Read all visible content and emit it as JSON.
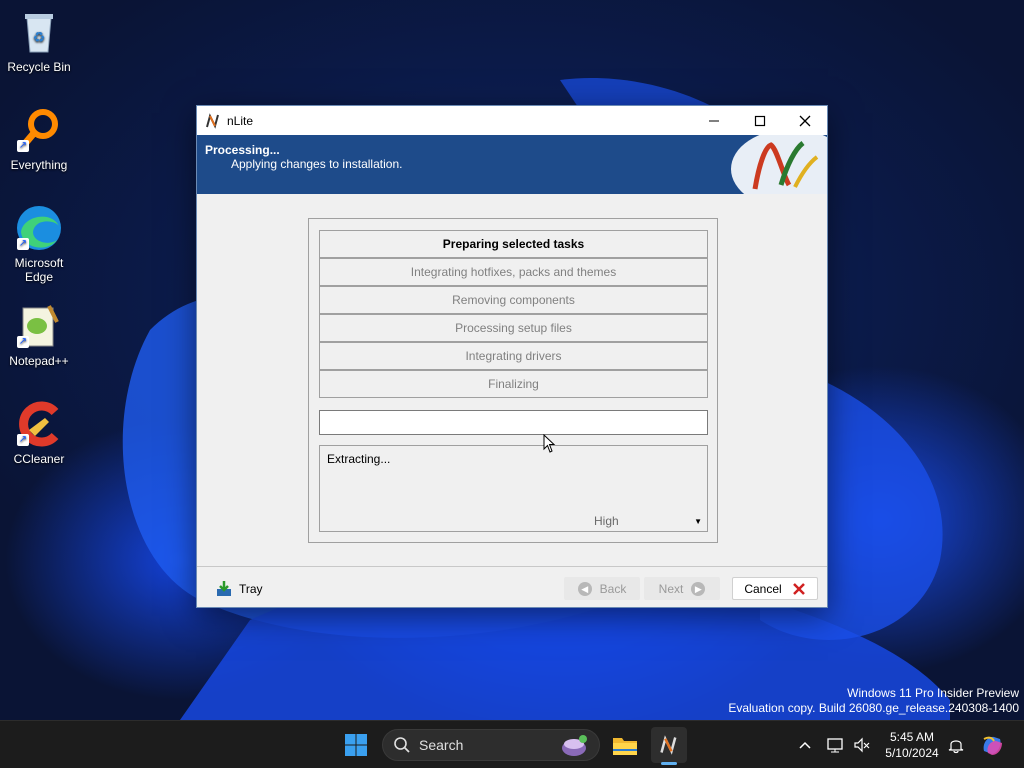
{
  "desktop": {
    "icons": [
      {
        "label": "Recycle Bin",
        "icon": "recycle-bin-icon"
      },
      {
        "label": "Everything",
        "icon": "everything-search-icon"
      },
      {
        "label": "Microsoft Edge",
        "icon": "edge-icon"
      },
      {
        "label": "Notepad++",
        "icon": "notepadpp-icon"
      },
      {
        "label": "CCleaner",
        "icon": "ccleaner-icon"
      }
    ]
  },
  "window": {
    "title": "nLite",
    "banner": {
      "heading": "Processing...",
      "subheading": "Applying changes to installation."
    },
    "tasks": [
      {
        "label": "Preparing selected tasks",
        "state": "active"
      },
      {
        "label": "Integrating hotfixes, packs and themes",
        "state": "pending"
      },
      {
        "label": "Removing components",
        "state": "pending"
      },
      {
        "label": "Processing setup files",
        "state": "pending"
      },
      {
        "label": "Integrating drivers",
        "state": "pending"
      },
      {
        "label": "Finalizing",
        "state": "pending"
      }
    ],
    "progress_fraction": 0,
    "log_text": "Extracting...",
    "priority": {
      "selected": "High"
    },
    "footer": {
      "tray_label": "Tray",
      "back_label": "Back",
      "next_label": "Next",
      "cancel_label": "Cancel"
    }
  },
  "watermark": {
    "line1": "Windows 11 Pro Insider Preview",
    "line2": "Evaluation copy. Build 26080.ge_release.240308-1400"
  },
  "taskbar": {
    "search_placeholder": "Search",
    "time": "5:45 AM",
    "date": "5/10/2024",
    "accent_color": "#0078d4"
  }
}
